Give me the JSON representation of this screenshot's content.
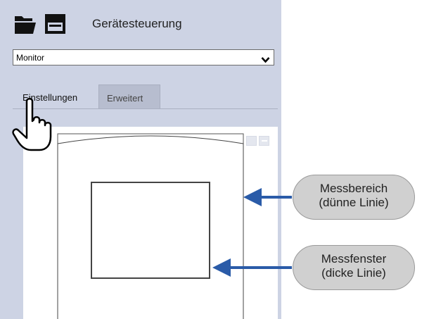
{
  "toolbar": {
    "title": "Gerätesteuerung",
    "icons": [
      "folder-open-icon",
      "save-icon"
    ]
  },
  "device_select": {
    "selected": "Monitor",
    "icon": "chevron-down-icon"
  },
  "tabs": [
    {
      "label": "Einstellungen",
      "active": true
    },
    {
      "label": "Erweitert",
      "active": false
    }
  ],
  "callouts": [
    {
      "line1": "Messbereich",
      "line2": "(dünne Linie)"
    },
    {
      "line1": "Messfenster",
      "line2": "(dicke Linie)"
    }
  ],
  "colors": {
    "panel": "#cdd3e4",
    "arrow": "#2a5ba8",
    "callout": "#d0d0d0"
  }
}
